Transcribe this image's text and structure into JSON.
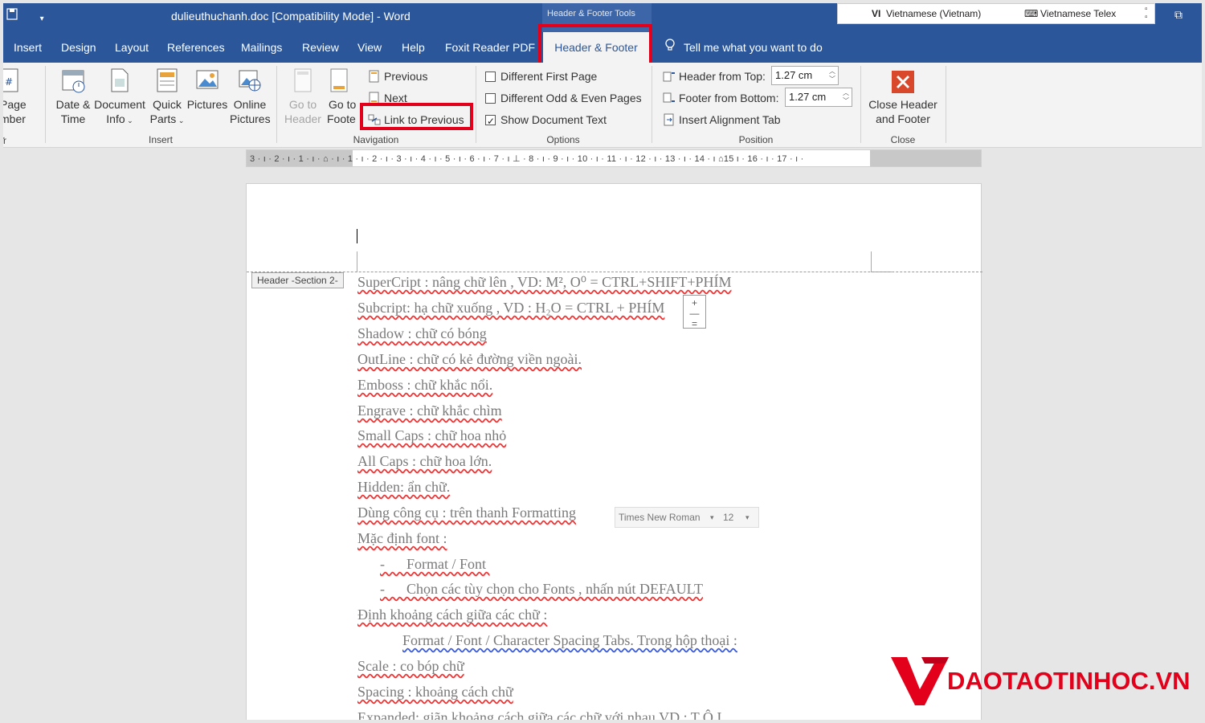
{
  "titlebar": {
    "quick_access_icon": "save-icon",
    "title": "dulieuthuchanh.doc [Compatibility Mode]  -  Word",
    "contextual_label": "Header & Footer Tools",
    "language_code": "VI",
    "language_name": "Vietnamese (Vietnam)",
    "input_method": "Vietnamese Telex"
  },
  "tabs": [
    {
      "label": "Insert"
    },
    {
      "label": "Design"
    },
    {
      "label": "Layout"
    },
    {
      "label": "References"
    },
    {
      "label": "Mailings"
    },
    {
      "label": "Review"
    },
    {
      "label": "View"
    },
    {
      "label": "Help"
    },
    {
      "label": "Foxit Reader PDF"
    },
    {
      "label": "Header & Footer"
    }
  ],
  "tell_me": "Tell me what you want to do",
  "ribbon": {
    "insert_group": {
      "label": "Insert",
      "page_number_line1": "Page",
      "page_number_line2": "mber",
      "prev_label": "r",
      "date_time_line1": "Date &",
      "date_time_line2": "Time",
      "doc_info_line1": "Document",
      "doc_info_line2": "Info",
      "quick_parts_line1": "Quick",
      "quick_parts_line2": "Parts",
      "pictures": "Pictures",
      "online_pictures_line1": "Online",
      "online_pictures_line2": "Pictures"
    },
    "navigation_group": {
      "label": "Navigation",
      "goto_header_line1": "Go to",
      "goto_header_line2": "Header",
      "goto_footer_line1": "Go to",
      "goto_footer_line2": "Foote",
      "previous": "Previous",
      "next": "Next",
      "link_to_previous": "Link to Previous"
    },
    "options_group": {
      "label": "Options",
      "different_first_page": "Different First Page",
      "different_odd_even": "Different Odd & Even Pages",
      "show_document_text": "Show Document Text",
      "different_first_page_checked": false,
      "different_odd_even_checked": false,
      "show_document_text_checked": true
    },
    "position_group": {
      "label": "Position",
      "header_from_top": "Header from Top:",
      "header_from_top_value": "1.27 cm",
      "footer_from_bottom": "Footer from Bottom:",
      "footer_from_bottom_value": "1.27 cm",
      "insert_alignment_tab": "Insert Alignment Tab"
    },
    "close_group": {
      "label": "Close",
      "close_line1": "Close Header",
      "close_line2": "and Footer"
    }
  },
  "ruler": {
    "numbers": "3 · ı · 2 · ı · 1 · ı · ⌂ · ı · 1 · ı · 2 · ı · 3 · ı · 4 · ı · 5 · ı · 6 · ı · 7 · ı ⊥ · 8 · ı · 9 · ı · 10 · ı · 11 · ı · 12 · ı · 13 · ı · 14 · ı ⌂15 ı · 16 · ı · 17 · ı ·"
  },
  "document": {
    "section_tag": "Header -Section 2-",
    "lines": [
      "SuperCript : nâng chữ lên , VD: M², O⁰ = CTRL+SHIFT+PHÍM",
      "Subcript: hạ chữ xuống , VD : H₂O = CTRL + PHÍM",
      "Shadow : chữ có bóng",
      "OutLine : chữ có kẻ đường viền ngoài.",
      "Emboss : chữ khắc nổi.",
      "Engrave : chữ khắc chìm",
      "Small Caps : chữ hoa nhỏ",
      "All Caps : chữ hoa lớn.",
      "Hidden: ẩn chữ.",
      "Dùng công  cụ : trên thanh Formatting",
      "Mặc định font :",
      "-      Format / Font ",
      "-      Chọn các tùy chọn cho Fonts , nhấn nút DEFAULT",
      "Định khoảng cách giữa các chữ :",
      "Format / Font / Character Spacing Tabs. Trong hộp thoại :",
      "Scale : co bóp chữ",
      "Spacing : khoảng cách chữ",
      "Expanded: giãn khoảng cách giữa các chữ với nhau   VD : T  Ô     I"
    ],
    "font_name": "Times New Roman",
    "font_size": "12"
  },
  "logo": {
    "text": "DAOTAOTINHOC.VN",
    "color_red": "#e3001b"
  },
  "colors": {
    "word_blue": "#2b579a",
    "highlight_red": "#e3001b"
  }
}
